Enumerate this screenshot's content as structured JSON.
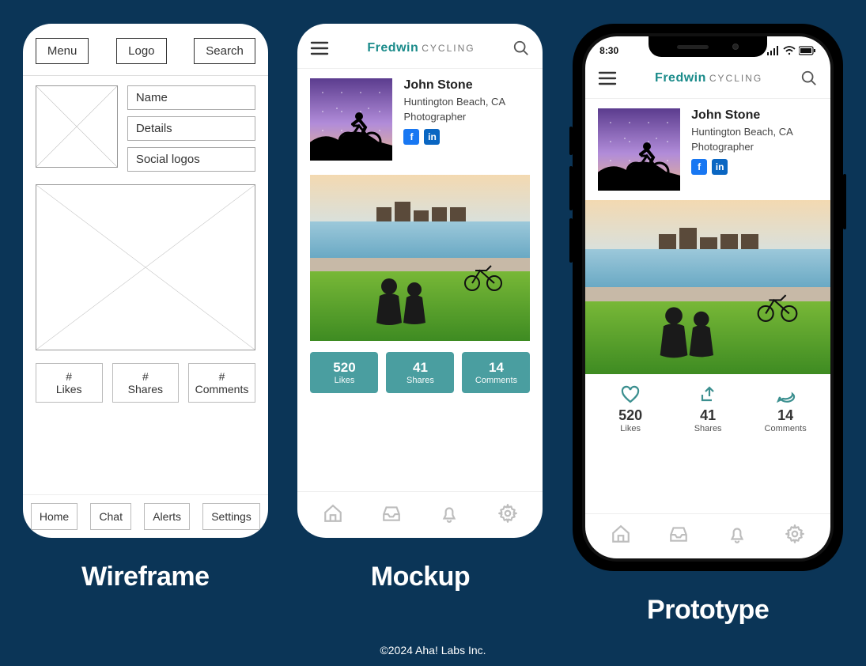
{
  "captions": {
    "wireframe": "Wireframe",
    "mockup": "Mockup",
    "prototype": "Prototype"
  },
  "footer": "©2024 Aha! Labs Inc.",
  "brand": {
    "part1": "Fredwin",
    "part2": "CYCLING"
  },
  "wireframe": {
    "top": {
      "menu": "Menu",
      "logo": "Logo",
      "search": "Search"
    },
    "fields": {
      "name": "Name",
      "details": "Details",
      "socials": "Social logos"
    },
    "stats": {
      "likes_symbol": "#",
      "likes_label": "Likes",
      "shares_symbol": "#",
      "shares_label": "Shares",
      "comments_symbol": "#",
      "comments_label": "Comments"
    },
    "nav": {
      "home": "Home",
      "chat": "Chat",
      "alerts": "Alerts",
      "settings": "Settings"
    }
  },
  "profile": {
    "name": "John Stone",
    "location": "Huntington Beach, CA",
    "role": "Photographer"
  },
  "stats": {
    "likes": {
      "value": "520",
      "label": "Likes"
    },
    "shares": {
      "value": "41",
      "label": "Shares"
    },
    "comments": {
      "value": "14",
      "label": "Comments"
    }
  },
  "prototype": {
    "time": "8:30"
  }
}
